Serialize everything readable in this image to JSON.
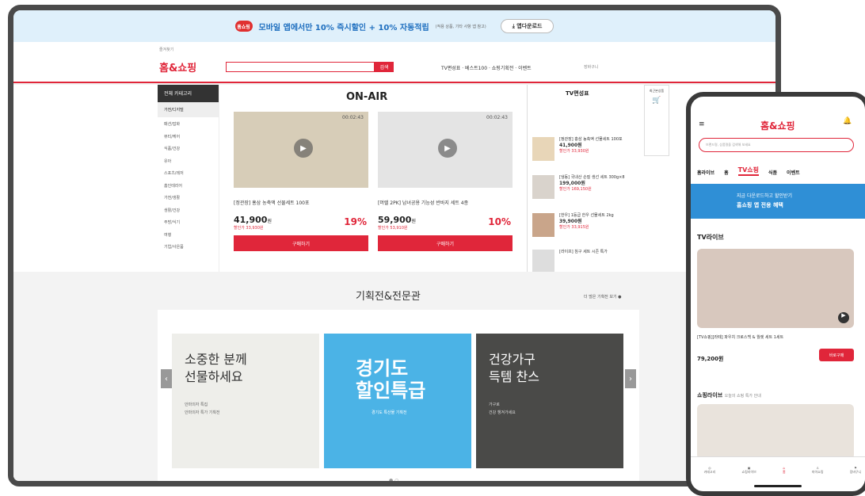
{
  "banner": {
    "text": "모바일 앱에서만 10% 즉시할인 + 10% 자동적립",
    "small": "(적용 상품, 기타 사항 앱 참고)",
    "app_download": "앱다운로드",
    "logo": "홈쇼핑"
  },
  "header": {
    "brand": "홈&쇼핑",
    "search_btn": "검색",
    "nav": "TV편성표 · 베스트100 · 쇼핑기획전 · 이벤트",
    "cart": "장바구니"
  },
  "left_categories": {
    "head": "전체 카테고리",
    "selected": "가전/디지털",
    "items": [
      "패션/잡화",
      "뷰티/케어",
      "식품/건강",
      "유아",
      "스포츠/레저",
      "홈인테리어",
      "가전/생활",
      "생활/건강",
      "주방/식기",
      "여행",
      "기업/사은품"
    ]
  },
  "onair": {
    "title": "ON-AIR",
    "products": [
      {
        "timer": "00:02:43",
        "title": "[정관장] 홍삼 농축액 선물세트 100포",
        "price": "41,900",
        "unit": "원",
        "disc": "19",
        "sub": "할인가 33,930원",
        "buy": "구매하기"
      },
      {
        "timer": "00:02:43",
        "title": "[머렐 2PK] 남녀공용 기능성 반바지 세트 4종",
        "price": "59,900",
        "unit": "원",
        "disc": "10",
        "sub": "할인가 53,910원",
        "buy": "구매하기"
      }
    ]
  },
  "tv_schedule": {
    "title": "TV편성표",
    "items": [
      {
        "t": "[정관장] 홍삼 농축액 선물세트 100포",
        "p": "41,900원",
        "s": "할인가 33,930원"
      },
      {
        "t": "[냉동] 국내산 손질 생선 세트 300g×8",
        "p": "199,000원",
        "s": "할인가 169,150원"
      },
      {
        "t": "[한우] 1등급 한우 선물세트 2kg",
        "p": "39,900원",
        "s": "할인가 33,915원"
      },
      {
        "t": "[라이프] 침구 세트 시즌 특가",
        "p": "",
        "s": ""
      }
    ]
  },
  "right_side": {
    "label": "최근본상품"
  },
  "section": {
    "title": "기획전&전문관",
    "more": "더 많은 기획전 보기",
    "promos": [
      {
        "text1": "소중한 분께",
        "text2": "선물하세요",
        "sub1": "안마의자 특집",
        "sub2": "안마의자 특가 기획전"
      },
      {
        "text1": "경기도",
        "text2": "할인특급",
        "sub1": "경기도 특산물 기획전",
        "sub2": ""
      },
      {
        "text1": "건강가구",
        "text2": "득템 찬스",
        "sub1": "가구로",
        "sub2": "건강 챙겨가세요"
      }
    ]
  },
  "phone": {
    "brand": "홈&쇼핑",
    "search_placeholder": "브랜드명, 상품명을 검색해 보세요",
    "tabs": [
      "홈라이브",
      "홈",
      "TV쇼핑",
      "식품",
      "이벤트"
    ],
    "banner": "홈쇼핑 앱 전용 혜택",
    "banner_sub": "지금 다운로드하고 할인받기",
    "tvlive": "TV라이브",
    "prod": "[TV쇼핑][라떼] 파우치 크로스백 & 월렛 세트 1세트",
    "price": "79,200원",
    "buy": "바로구매",
    "live2": "쇼핑라이브",
    "live2_sub": "오늘의 쇼핑 특가 안내",
    "nav": [
      "카테고리",
      "쇼핑라이브",
      "홈",
      "마이쇼핑",
      "장바구니"
    ]
  }
}
